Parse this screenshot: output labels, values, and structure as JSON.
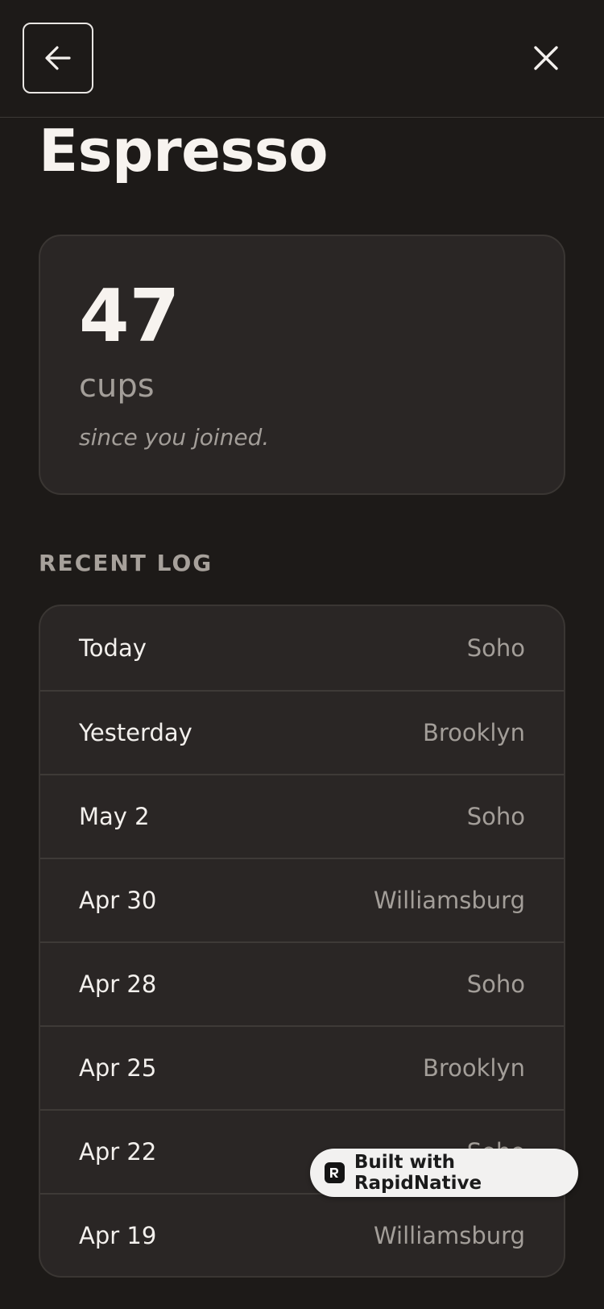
{
  "header": {
    "back_icon": "arrow-left-icon",
    "close_icon": "close-icon"
  },
  "page": {
    "title": "Espresso"
  },
  "stat": {
    "value": "47",
    "unit": "cups",
    "subtitle": "since you joined."
  },
  "recent_log": {
    "label": "RECENT LOG",
    "rows": [
      {
        "date": "Today",
        "place": "Soho"
      },
      {
        "date": "Yesterday",
        "place": "Brooklyn"
      },
      {
        "date": "May 2",
        "place": "Soho"
      },
      {
        "date": "Apr 30",
        "place": "Williamsburg"
      },
      {
        "date": "Apr 28",
        "place": "Soho"
      },
      {
        "date": "Apr 25",
        "place": "Brooklyn"
      },
      {
        "date": "Apr 22",
        "place": "Soho"
      },
      {
        "date": "Apr 19",
        "place": "Williamsburg"
      }
    ]
  },
  "badge": {
    "label": "Built with RapidNative",
    "logo_letter": "R"
  },
  "colors": {
    "background": "#1d1a18",
    "card": "#2a2625",
    "text_primary": "#f3f0ed",
    "text_secondary": "#a39e99"
  }
}
